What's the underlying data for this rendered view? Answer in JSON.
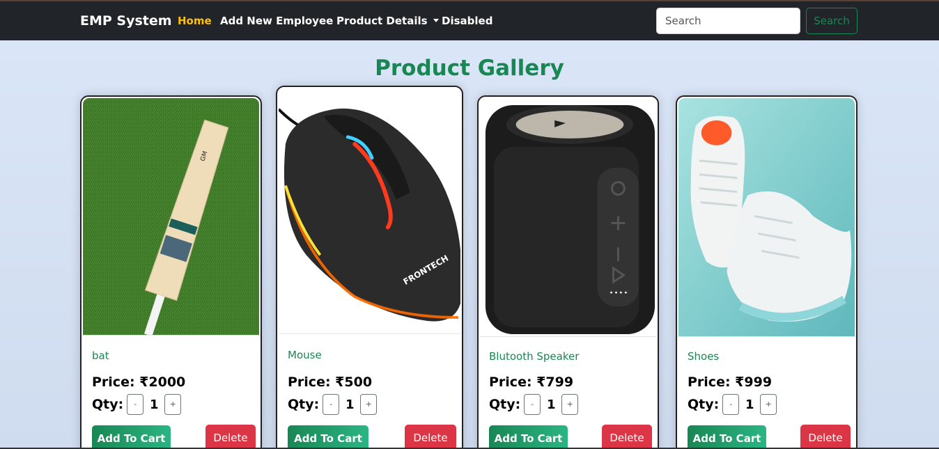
{
  "navbar": {
    "brand": "EMP System",
    "links": [
      {
        "label": "Home",
        "active": true
      },
      {
        "label": "Add New Employee"
      },
      {
        "label": "Product Details"
      },
      {
        "label": "Disabled"
      }
    ],
    "search_placeholder": "Search",
    "search_button": "Search"
  },
  "page_title": "Product Gallery",
  "products": [
    {
      "name": "bat",
      "price": "Price: ₹2000",
      "qty_label": "Qty:",
      "qty": "1",
      "minus": "-",
      "plus": "+",
      "add_label": "Add To Cart",
      "delete_label": "Delete",
      "image_icon": "cricket-bat-icon"
    },
    {
      "name": "Mouse",
      "price": "Price: ₹500",
      "qty_label": "Qty:",
      "qty": "1",
      "minus": "-",
      "plus": "+",
      "add_label": "Add To Cart",
      "delete_label": "Delete",
      "image_icon": "mouse-icon",
      "image_text": "FRONTECH"
    },
    {
      "name": "Blutooth Speaker",
      "price": "Price: ₹799",
      "qty_label": "Qty:",
      "qty": "1",
      "minus": "-",
      "plus": "+",
      "add_label": "Add To Cart",
      "delete_label": "Delete",
      "image_icon": "speaker-icon"
    },
    {
      "name": "Shoes",
      "price": "Price: ₹999",
      "qty_label": "Qty:",
      "qty": "1",
      "minus": "-",
      "plus": "+",
      "add_label": "Add To Cart",
      "delete_label": "Delete",
      "image_icon": "shoes-icon"
    }
  ],
  "colors": {
    "navbar_bg": "#212529",
    "active_link": "#ffc107",
    "accent_green": "#198754",
    "danger": "#dc3545"
  }
}
